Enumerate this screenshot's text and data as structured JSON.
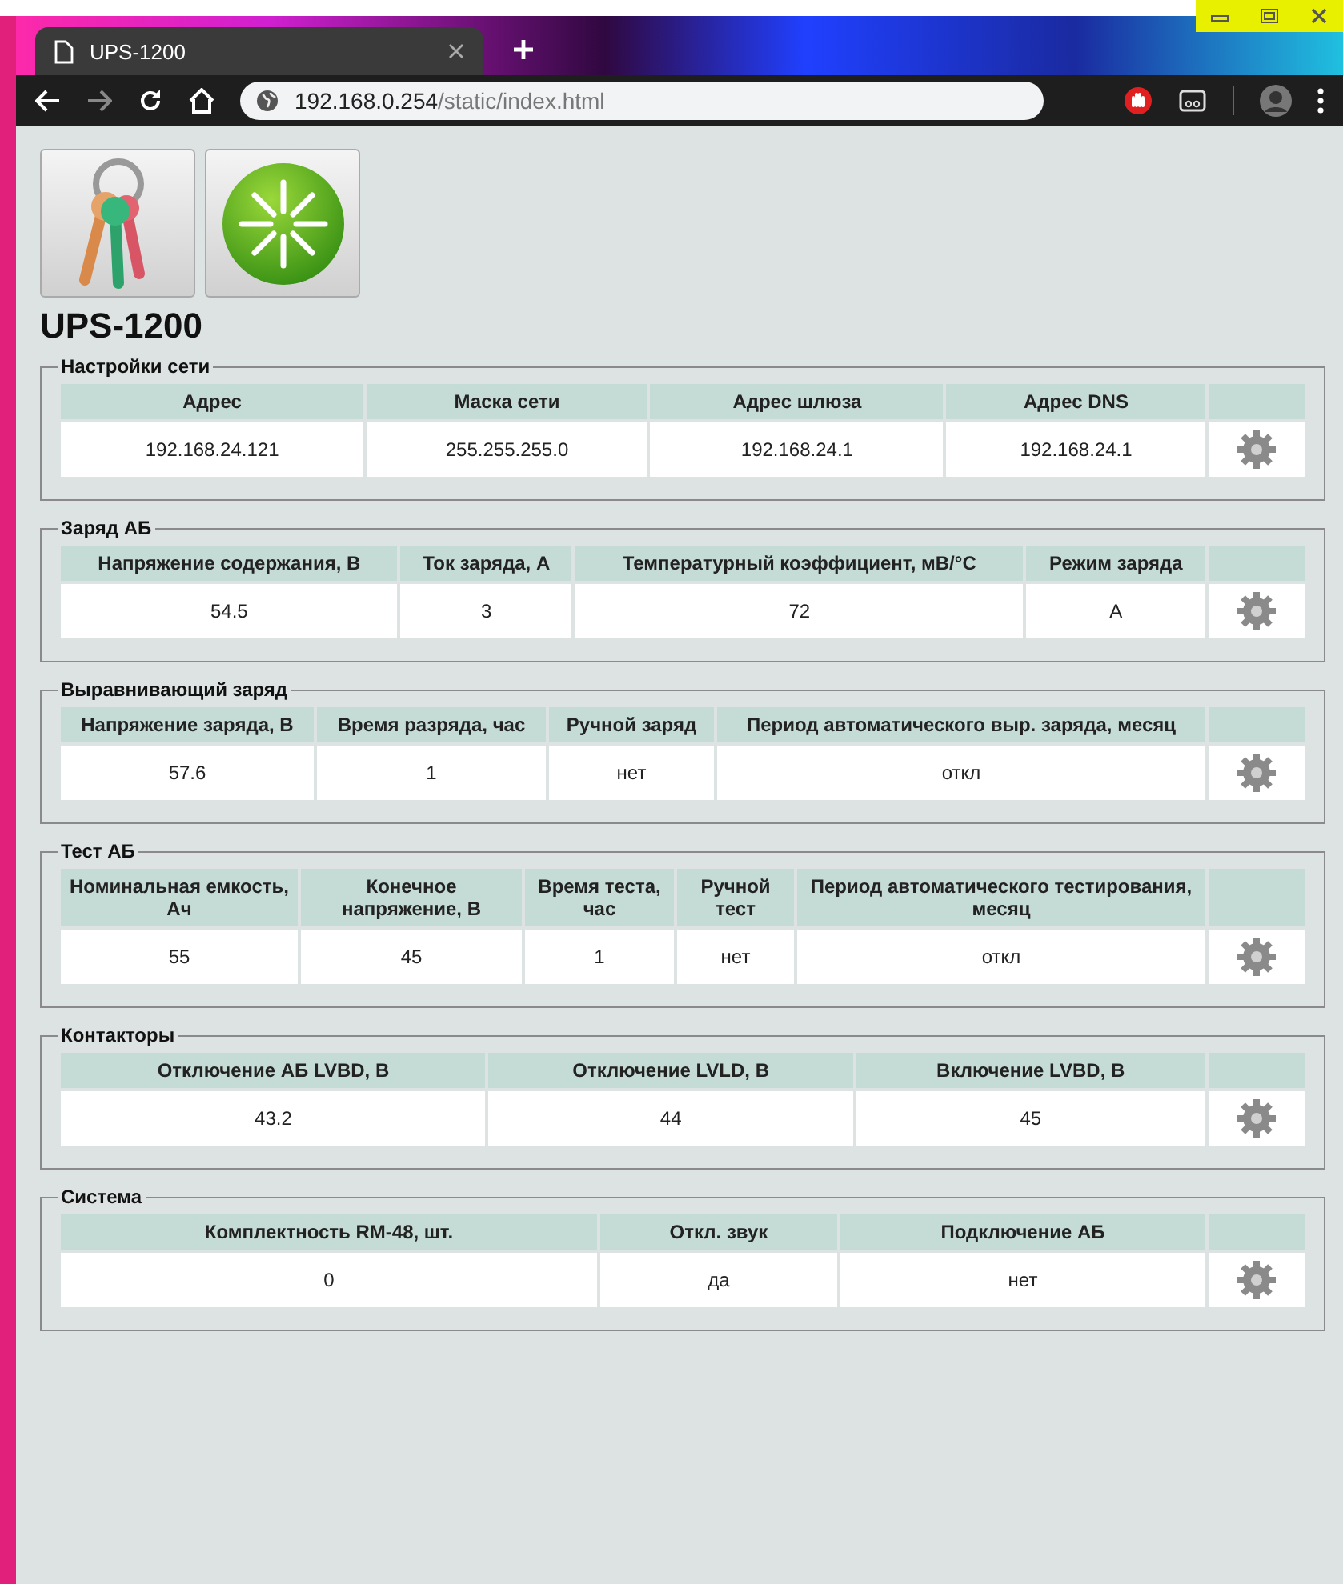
{
  "browser": {
    "tab_title": "UPS-1200",
    "url_host": "192.168.0.254",
    "url_path": "/static/index.html"
  },
  "page": {
    "title": "UPS-1200"
  },
  "sections": [
    {
      "title": "Настройки сети",
      "columns": [
        "Адрес",
        "Маска сети",
        "Адрес шлюза",
        "Адрес DNS"
      ],
      "values": [
        "192.168.24.121",
        "255.255.255.0",
        "192.168.24.1",
        "192.168.24.1"
      ]
    },
    {
      "title": "Заряд АБ",
      "columns": [
        "Напряжение содержания, В",
        "Ток заряда, А",
        "Температурный коэффициент, мВ/°С",
        "Режим заряда"
      ],
      "values": [
        "54.5",
        "3",
        "72",
        "А"
      ]
    },
    {
      "title": "Выравнивающий заряд",
      "columns": [
        "Напряжение заряда, В",
        "Время разряда, час",
        "Ручной заряд",
        "Период автоматического выр. заряда, месяц"
      ],
      "values": [
        "57.6",
        "1",
        "нет",
        "откл"
      ]
    },
    {
      "title": "Тест АБ",
      "columns": [
        "Номинальная емкость, Ач",
        "Конечное напряжение, В",
        "Время теста, час",
        "Ручной тест",
        "Период автоматического тестирования, месяц"
      ],
      "values": [
        "55",
        "45",
        "1",
        "нет",
        "откл"
      ]
    },
    {
      "title": "Контакторы",
      "columns": [
        "Отключение АБ LVBD, В",
        "Отключение LVLD, В",
        "Включение LVBD, В"
      ],
      "values": [
        "43.2",
        "44",
        "45"
      ]
    },
    {
      "title": "Система",
      "columns": [
        "Комплектность RM-48, шт.",
        "Откл. звук",
        "Подключение АБ"
      ],
      "values": [
        "0",
        "да",
        "нет"
      ]
    }
  ]
}
